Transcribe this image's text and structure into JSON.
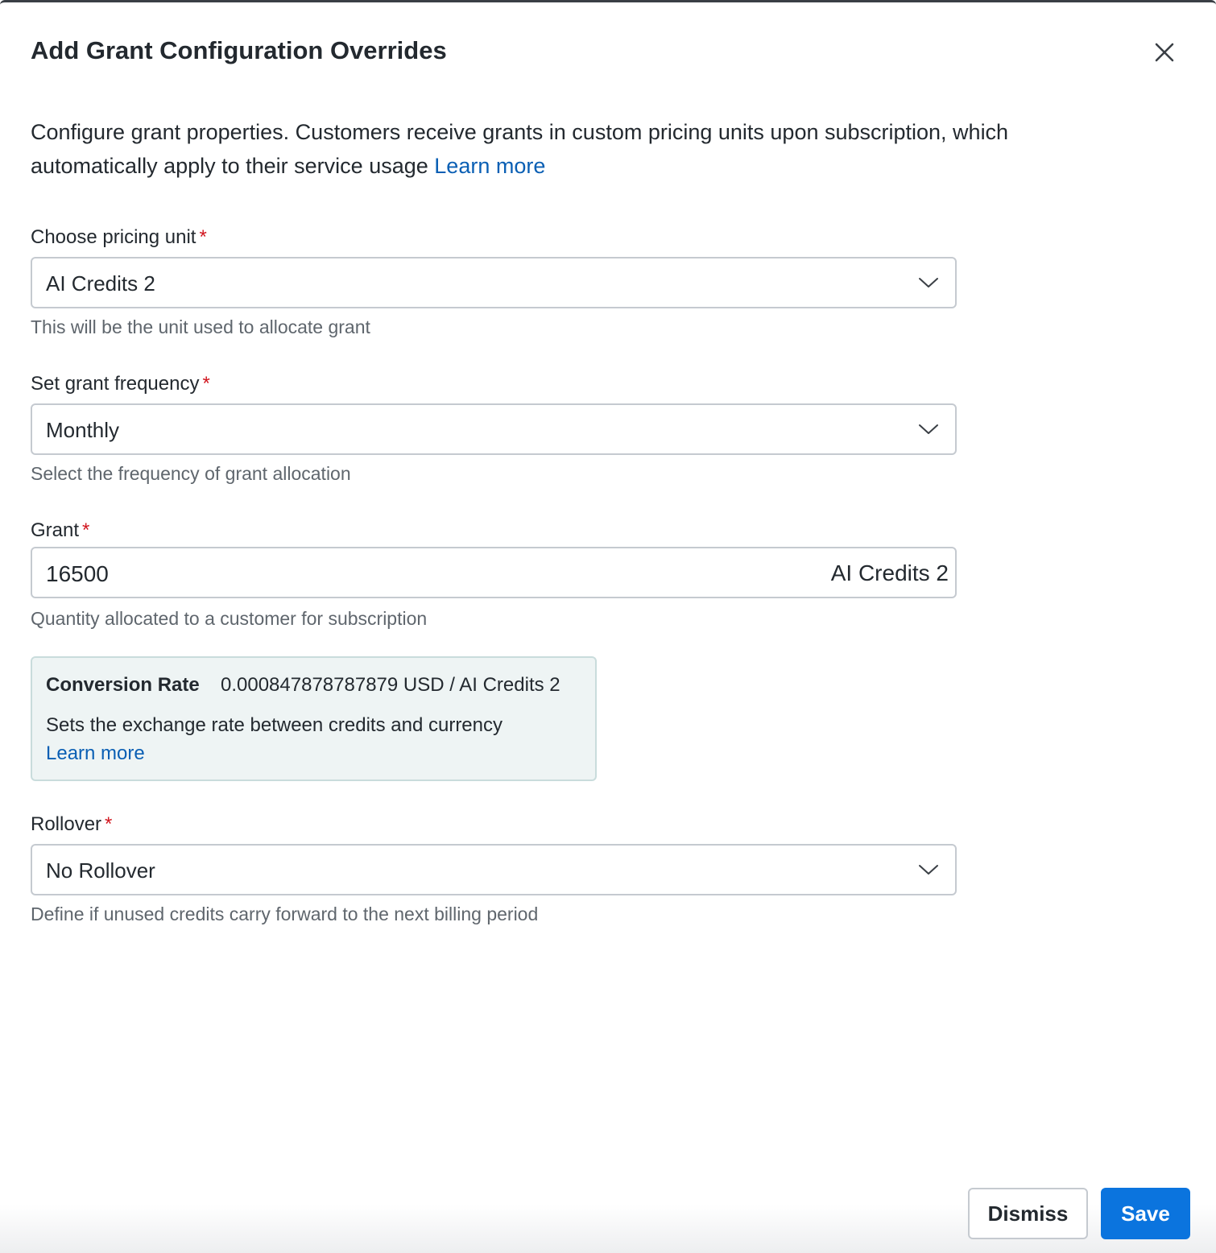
{
  "modal": {
    "title": "Add Grant Configuration Overrides",
    "close_icon": "close-icon",
    "intro_text": "Configure grant properties. Customers receive grants in custom pricing units upon subscription, which automatically apply to their service usage",
    "intro_link": "Learn more"
  },
  "fields": {
    "pricing_unit": {
      "label": "Choose pricing unit",
      "required_mark": "*",
      "value": "AI Credits 2",
      "help": "This will be the unit used to allocate grant"
    },
    "frequency": {
      "label": "Set grant frequency",
      "required_mark": "*",
      "value": "Monthly",
      "help": "Select the frequency of grant allocation"
    },
    "grant": {
      "label": "Grant",
      "required_mark": "*",
      "value": "16500",
      "suffix": "AI Credits 2",
      "help": "Quantity allocated to a customer for subscription"
    },
    "conversion": {
      "label": "Conversion Rate",
      "value": "0.000847878787879 USD / AI Credits 2",
      "description": "Sets the exchange rate between credits and currency",
      "link": "Learn more"
    },
    "rollover": {
      "label": "Rollover",
      "required_mark": "*",
      "value": "No Rollover",
      "help": "Define if unused credits carry forward to the next billing period"
    }
  },
  "footer": {
    "dismiss_label": "Dismiss",
    "save_label": "Save"
  },
  "colors": {
    "primary": "#0b74de",
    "link": "#0a5fb4",
    "required": "#d1151e",
    "info_bg": "#eef4f4"
  }
}
